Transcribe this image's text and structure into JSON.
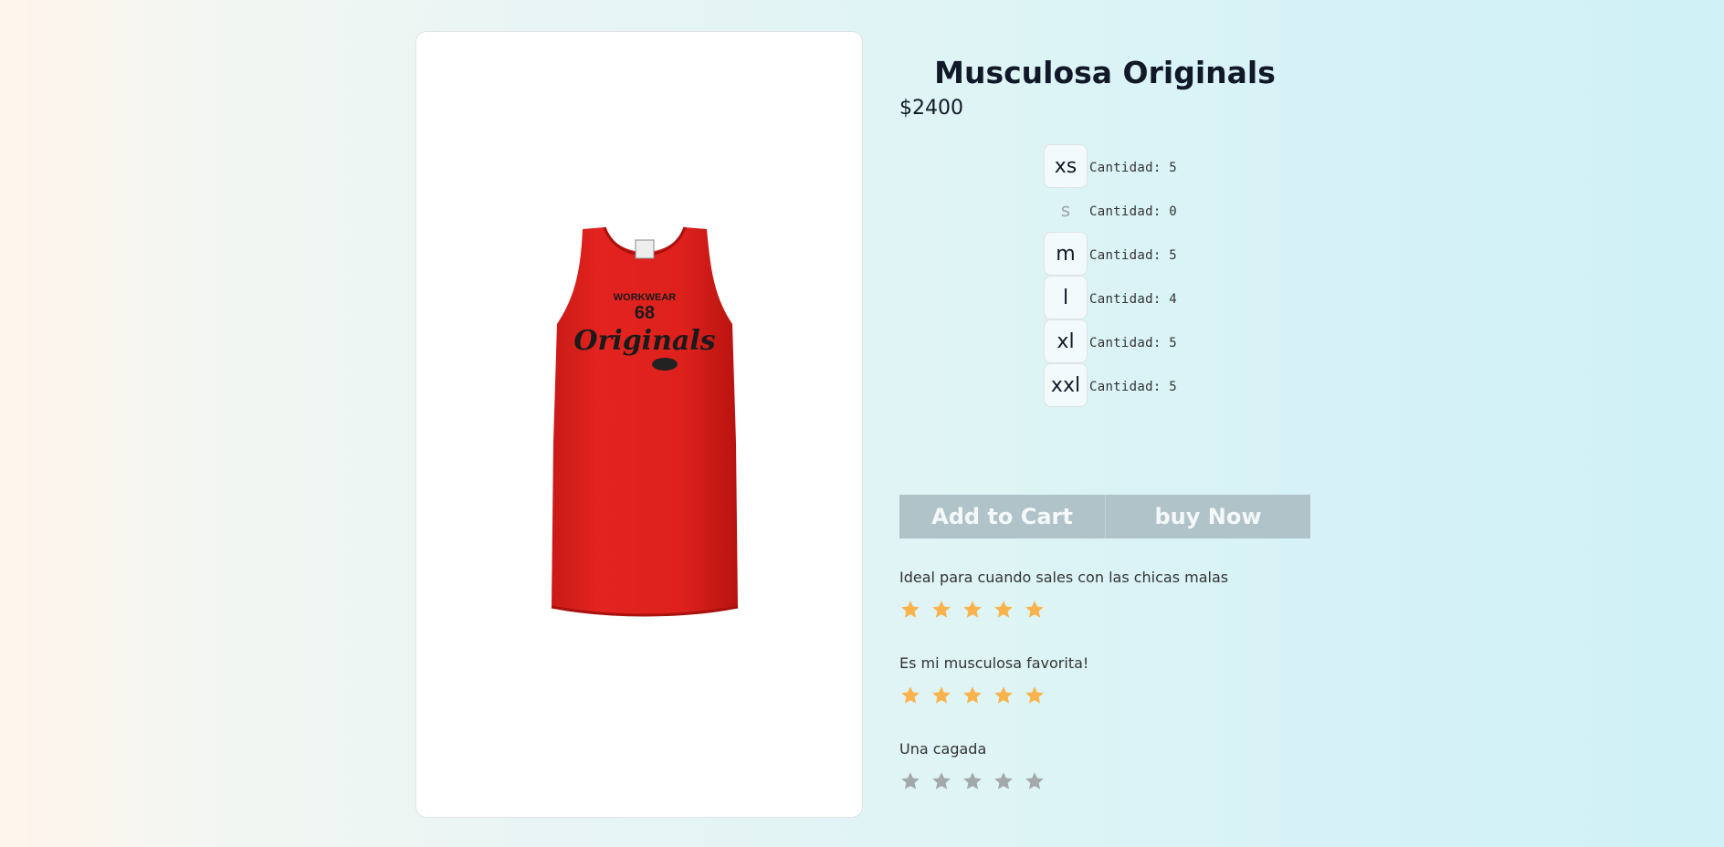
{
  "product": {
    "title": "Musculosa Originals",
    "price": "$2400",
    "image_print": {
      "line1": "WORKWEAR",
      "line2": "68",
      "line3": "Originals"
    }
  },
  "sizes": [
    {
      "label": "xs",
      "stock": "Cantidad: 5",
      "available": true
    },
    {
      "label": "s",
      "stock": "Cantidad: 0",
      "available": false
    },
    {
      "label": "m",
      "stock": "Cantidad: 5",
      "available": true
    },
    {
      "label": "l",
      "stock": "Cantidad: 4",
      "available": true
    },
    {
      "label": "xl",
      "stock": "Cantidad: 5",
      "available": true
    },
    {
      "label": "xxl",
      "stock": "Cantidad: 5",
      "available": true
    }
  ],
  "actions": {
    "add_to_cart": "Add to Cart",
    "buy_now": "buy Now"
  },
  "reviews": [
    {
      "text": "Ideal para cuando sales con las chicas malas",
      "rating": 5
    },
    {
      "text": "Es mi musculosa favorita!",
      "rating": 5
    },
    {
      "text": "Una cagada",
      "rating": 0
    }
  ],
  "colors": {
    "star_filled": "#f9b34c",
    "star_empty": "#a3a8ab",
    "button_bg": "#b0c3c8",
    "shirt": "#e0221e"
  },
  "icons": {
    "star": "star-icon"
  }
}
